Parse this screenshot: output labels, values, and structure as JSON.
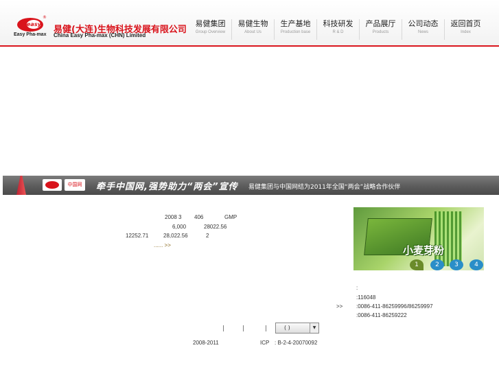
{
  "header": {
    "logo_text": "easy",
    "logo_reg": "®",
    "logo_caption": "Easy Pha-max",
    "company_cn": "易健(大连)生物科技发展有限公司",
    "company_en": "China  Easy  Pha-max (CHN) Limited"
  },
  "nav": [
    {
      "cn": "易健集团",
      "en": "Group Overview"
    },
    {
      "cn": "易健生物",
      "en": "About  Us"
    },
    {
      "cn": "生产基地",
      "en": "Production base"
    },
    {
      "cn": "科技研发",
      "en": "R & D"
    },
    {
      "cn": "产品展厅",
      "en": "Products"
    },
    {
      "cn": "公司动态",
      "en": "News"
    },
    {
      "cn": "返回首页",
      "en": "Index"
    }
  ],
  "banner": {
    "logo2": "中国网",
    "slogan": "牵手中国网,强势助力“两会”宣传",
    "text": "易健集团与中国网结为2011年全国“两会”战略合作伙伴"
  },
  "intro": {
    "line1a": "2008 3",
    "line1b": "406",
    "line1c": "GMP",
    "line2a": "6,000",
    "line2b": "28022.56",
    "line3a": "12252.71",
    "line3b": "28,022.56",
    "line3c": "2",
    "more": "......  >>"
  },
  "product": {
    "title": "小麦芽粉",
    "pages": [
      "1",
      "2",
      "3",
      "4"
    ]
  },
  "contact": {
    "colon": ":",
    "postcode": ":116048",
    "arrow": ">>",
    "phone": ":0086-411-86259996/86259997",
    "fax": ":0086-411-86259222"
  },
  "links": {
    "sep": "|",
    "select_value": "(   )",
    "select_arrow": "▼"
  },
  "footer": {
    "years": "2008-2011",
    "icp": "ICP",
    "icp_no": ": B-2-4-20070092"
  }
}
